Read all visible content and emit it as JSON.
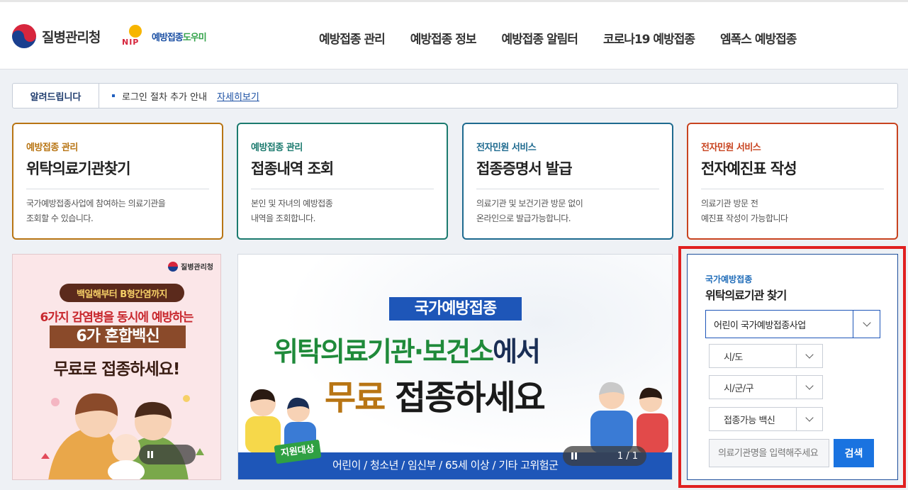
{
  "header": {
    "org_name": "질병관리청",
    "nip_letters": "NIP",
    "nip_text_a": "예방접종",
    "nip_text_b": "도우미",
    "nav": [
      "예방접종 관리",
      "예방접종 정보",
      "예방접종 알림터",
      "코로나19 예방접종",
      "엠폭스 예방접종"
    ]
  },
  "notice": {
    "label": "알려드립니다",
    "text": "로그인 절차 추가 안내",
    "link": "자세히보기"
  },
  "cards": [
    {
      "category": "예방접종 관리",
      "title": "위탁의료기관찾기",
      "desc1": "국가예방접종사업에 참여하는 의료기관을",
      "desc2": "조회할 수 있습니다.",
      "color": "#b87514"
    },
    {
      "category": "예방접종 관리",
      "title": "접종내역 조회",
      "desc1": "본인 및 자녀의 예방접종",
      "desc2": "내역을 조회합니다.",
      "color": "#1b7a6e"
    },
    {
      "category": "전자민원 서비스",
      "title": "접종증명서 발급",
      "desc1": "의료기관 및 보건기관 방문 없이",
      "desc2": "온라인으로 발급가능합니다.",
      "color": "#1e6a8f"
    },
    {
      "category": "전자민원 서비스",
      "title": "전자예진표 작성",
      "desc1": "의료기관 방문 전",
      "desc2": "예진표 작성이 가능합니다",
      "color": "#c8431f"
    }
  ],
  "banner_left": {
    "org": "질병관리청",
    "pill": "백일해부터 B형간염까지",
    "line1": "6가지 감염병을 동시에 예방하는",
    "line2": "6가 혼합백신",
    "line3": "무료로 접종하세요!"
  },
  "banner_center": {
    "tag": "국가예방접종",
    "line1_a": "위탁의료기관·보건소",
    "line1_b": "에서",
    "line2_a": "무료",
    "line2_b": " 접종하세요",
    "badge": "지원대상",
    "strip": "어린이 / 청소년 / 임신부 / 65세 이상 / 기타 고위험군",
    "counter": "1 / 1"
  },
  "search": {
    "category": "국가예방접종",
    "title": "위탁의료기관 찾기",
    "program": "어린이 국가예방접종사업",
    "sido": "시/도",
    "sigungu": "시/군/구",
    "vaccine": "접종가능 백신",
    "placeholder": "의료기관명을 입력해주세요",
    "button": "검색"
  }
}
